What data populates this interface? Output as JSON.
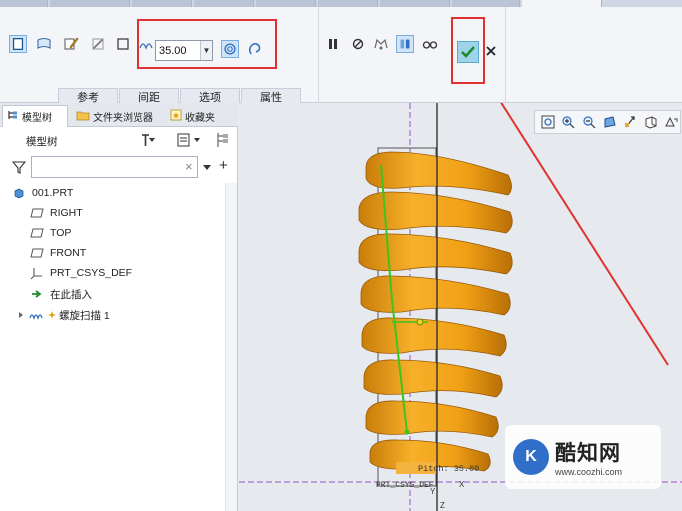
{
  "ribbon": {
    "pitch_value": "35.00",
    "dropdown_arrow": "▼",
    "tabs": [
      "参考",
      "间距",
      "选项",
      "属性"
    ]
  },
  "panel": {
    "tabs": [
      "模型树",
      "文件夹浏览器",
      "收藏夹"
    ],
    "tree_title": "模型树",
    "filter_placeholder": "",
    "filter_clear": "×",
    "add_symbol": "+",
    "tree": {
      "root": "001.PRT",
      "items": [
        "RIGHT",
        "TOP",
        "FRONT",
        "PRT_CSYS_DEF",
        "在此插入",
        "螺旋扫描 1"
      ]
    }
  },
  "viewport": {
    "pitch_label": "Pitch: 35.00",
    "csys_label": "PRT_CSYS_DEF",
    "axis_x": "X",
    "axis_y": "Y",
    "axis_z": "Z"
  },
  "watermark": {
    "brand": "酷知网",
    "url": "www.coozhi.com",
    "logo_text": "K"
  },
  "colors": {
    "accent": "#e0332f",
    "spring": "#f2a21a",
    "spring_dark": "#c47b09",
    "sketch_green": "#3ec41c",
    "datum_purple": "#9a4fc8"
  }
}
